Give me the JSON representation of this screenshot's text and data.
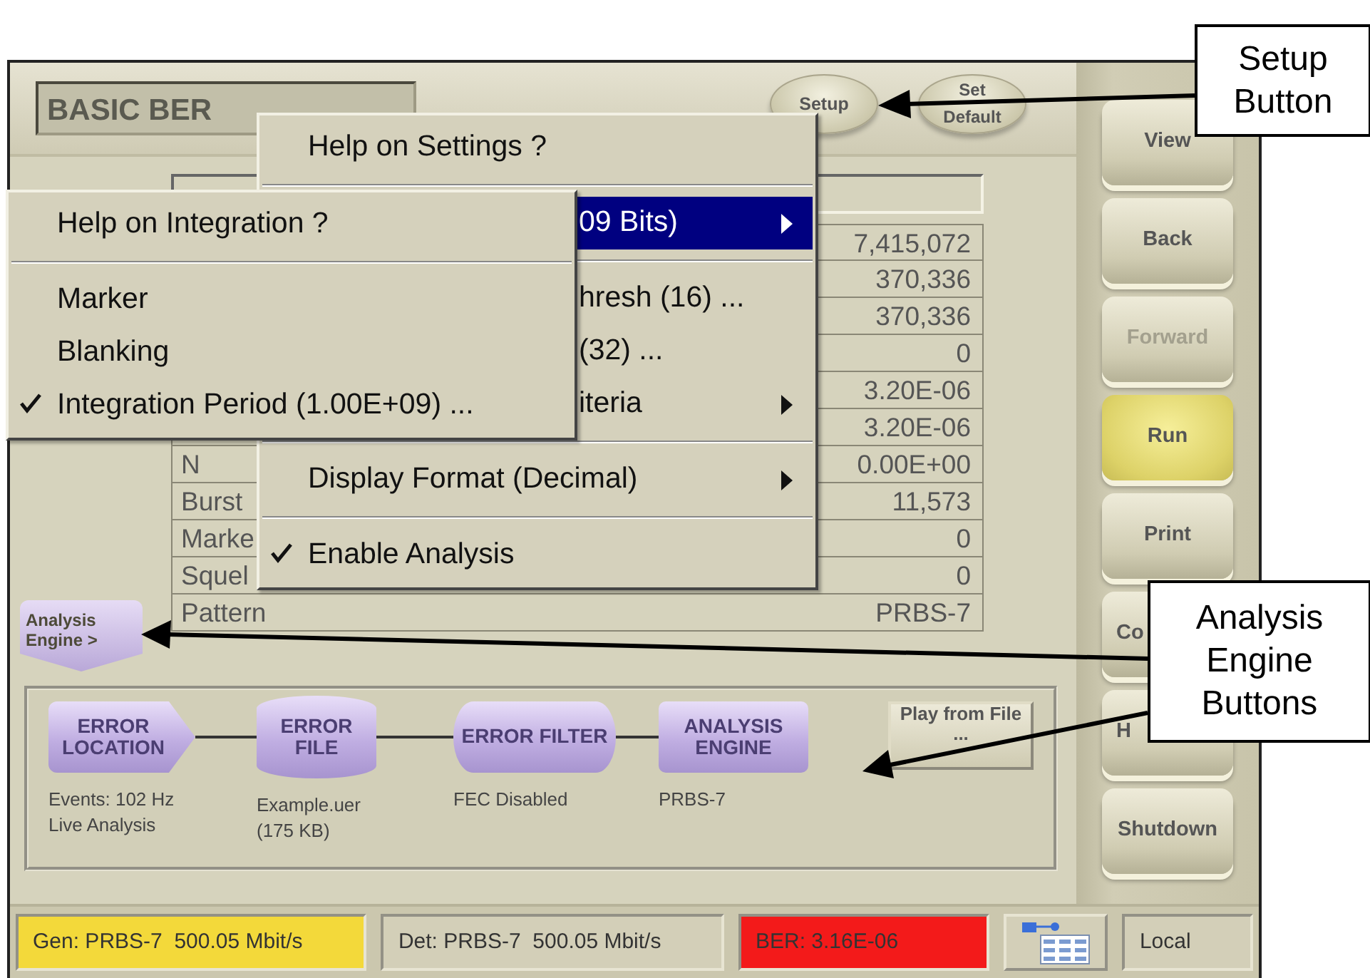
{
  "title": "BASIC BER",
  "header_buttons": [
    {
      "label": "Setup"
    },
    {
      "label": "Set Default"
    }
  ],
  "table": {
    "rows": [
      {
        "value": "7,415,072"
      },
      {
        "value": "370,336"
      },
      {
        "value": "370,336"
      },
      {
        "value": "0"
      },
      {
        "value": "3.20E-06"
      },
      {
        "value": "3.20E-06"
      },
      {
        "label": "N",
        "value": "0.00E+00"
      },
      {
        "label": "Burst",
        "value": "11,573"
      },
      {
        "label": "Marke",
        "value": "0"
      },
      {
        "label": "Squel",
        "value": "0"
      },
      {
        "label": "Pattern",
        "value": "PRBS-7"
      }
    ]
  },
  "settings_menu": {
    "items": [
      {
        "kind": "item",
        "label": "Help on Settings ?",
        "selected": false,
        "checked": false,
        "submenu": false
      },
      {
        "kind": "separator"
      },
      {
        "kind": "covered_item",
        "label": "09 Bits)",
        "selected": true,
        "submenu": true
      },
      {
        "kind": "separator"
      },
      {
        "kind": "covered_item",
        "label": "hresh (16) ...",
        "selected": false,
        "submenu": false
      },
      {
        "kind": "covered_item",
        "label": "(32) ...",
        "selected": false,
        "submenu": false
      },
      {
        "kind": "covered_item",
        "label": "iteria",
        "selected": false,
        "submenu": true
      },
      {
        "kind": "separator"
      },
      {
        "kind": "item",
        "label": "Display Format (Decimal)",
        "selected": false,
        "checked": false,
        "submenu": true
      },
      {
        "kind": "separator"
      },
      {
        "kind": "item",
        "label": "Enable Analysis",
        "selected": false,
        "checked": true,
        "submenu": false
      }
    ]
  },
  "integration_menu": {
    "items": [
      {
        "kind": "item",
        "label": "Help on Integration ?",
        "selected": false,
        "checked": false,
        "submenu": false
      },
      {
        "kind": "separator"
      },
      {
        "kind": "item",
        "label": "Marker",
        "selected": false,
        "checked": false,
        "submenu": false
      },
      {
        "kind": "item",
        "label": "Blanking",
        "selected": false,
        "checked": false,
        "submenu": false
      },
      {
        "kind": "item",
        "label": "Integration Period (1.00E+09) ...",
        "selected": false,
        "checked": true,
        "submenu": false
      }
    ]
  },
  "analysis_engine_button": {
    "label": "Analysis Engine >"
  },
  "flow": {
    "nodes": [
      {
        "label": "ERROR LOCATION",
        "kind": "pentagon",
        "caption": "Events: 102 Hz\nLive Analysis"
      },
      {
        "label": "ERROR FILE",
        "kind": "cylinder",
        "caption": "Example.uer\n(175 KB)"
      },
      {
        "label": "ERROR FILTER",
        "kind": "hcylinder",
        "caption": "FEC Disabled"
      },
      {
        "label": "ANALYSIS ENGINE",
        "kind": "box",
        "caption": "PRBS-7"
      }
    ],
    "play_button": {
      "label": "Play from File ..."
    }
  },
  "side_buttons": [
    {
      "kind": "button",
      "label": "View",
      "disabled": false,
      "lit": false
    },
    {
      "kind": "button",
      "label": "Back",
      "disabled": false,
      "lit": false
    },
    {
      "kind": "button",
      "label": "Forward",
      "disabled": true,
      "lit": false
    },
    {
      "kind": "button",
      "label": "Run",
      "disabled": false,
      "lit": true
    },
    {
      "kind": "button",
      "label": "Print",
      "disabled": false,
      "lit": false
    },
    {
      "kind": "covered",
      "label": "Co",
      "disabled": false,
      "lit": false
    },
    {
      "kind": "covered",
      "label": "H",
      "disabled": false,
      "lit": false
    },
    {
      "kind": "button",
      "label": "Shutdown",
      "disabled": false,
      "lit": false
    }
  ],
  "status_bar": [
    {
      "kind": "field",
      "text": "Gen: PRBS-7  500.05 Mbit/s",
      "color": "#f3d93a"
    },
    {
      "kind": "field",
      "text": "Det: PRBS-7  500.05 Mbit/s",
      "color": "#d3cfb8"
    },
    {
      "kind": "field",
      "text": "BER: 3.16E-06",
      "color": "#f31a1a"
    },
    {
      "kind": "icon"
    },
    {
      "kind": "field",
      "text": "Local",
      "color": "#d3cfb8"
    }
  ],
  "callouts": [
    {
      "text": "Setup\nButton"
    },
    {
      "text": "Analysis\nEngine\nButtons"
    }
  ]
}
